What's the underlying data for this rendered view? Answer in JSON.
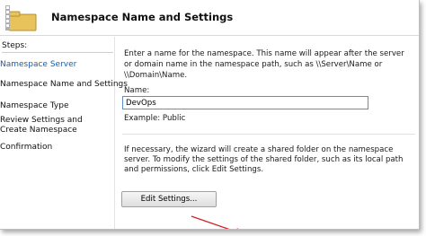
{
  "header": {
    "title": "Namespace Name and Settings",
    "icon": "folder-wizard-icon"
  },
  "sidebar": {
    "heading": "Steps:",
    "items": [
      {
        "label": "Namespace Server",
        "active": true
      },
      {
        "label": "Namespace Name and Settings",
        "active": false
      },
      {
        "label": "Namespace Type",
        "active": false
      },
      {
        "label": "Review Settings and Create Namespace",
        "active": false
      },
      {
        "label": "Confirmation",
        "active": false
      }
    ]
  },
  "main": {
    "description": "Enter a name for the namespace. This name will appear after the server or domain name in the namespace path, such as \\\\Server\\Name or \\\\Domain\\Name.",
    "name_label": "Name:",
    "name_value": "DevOps",
    "example": "Example: Public",
    "note": "If necessary, the wizard will create a shared folder on the namespace server. To modify the settings of the shared folder, such as its local path and permissions, click Edit Settings.",
    "edit_button_label": "Edit Settings..."
  },
  "colors": {
    "active_step": "#1060b8",
    "arrow": "#d42020",
    "input_border": "#5c8ec9"
  }
}
